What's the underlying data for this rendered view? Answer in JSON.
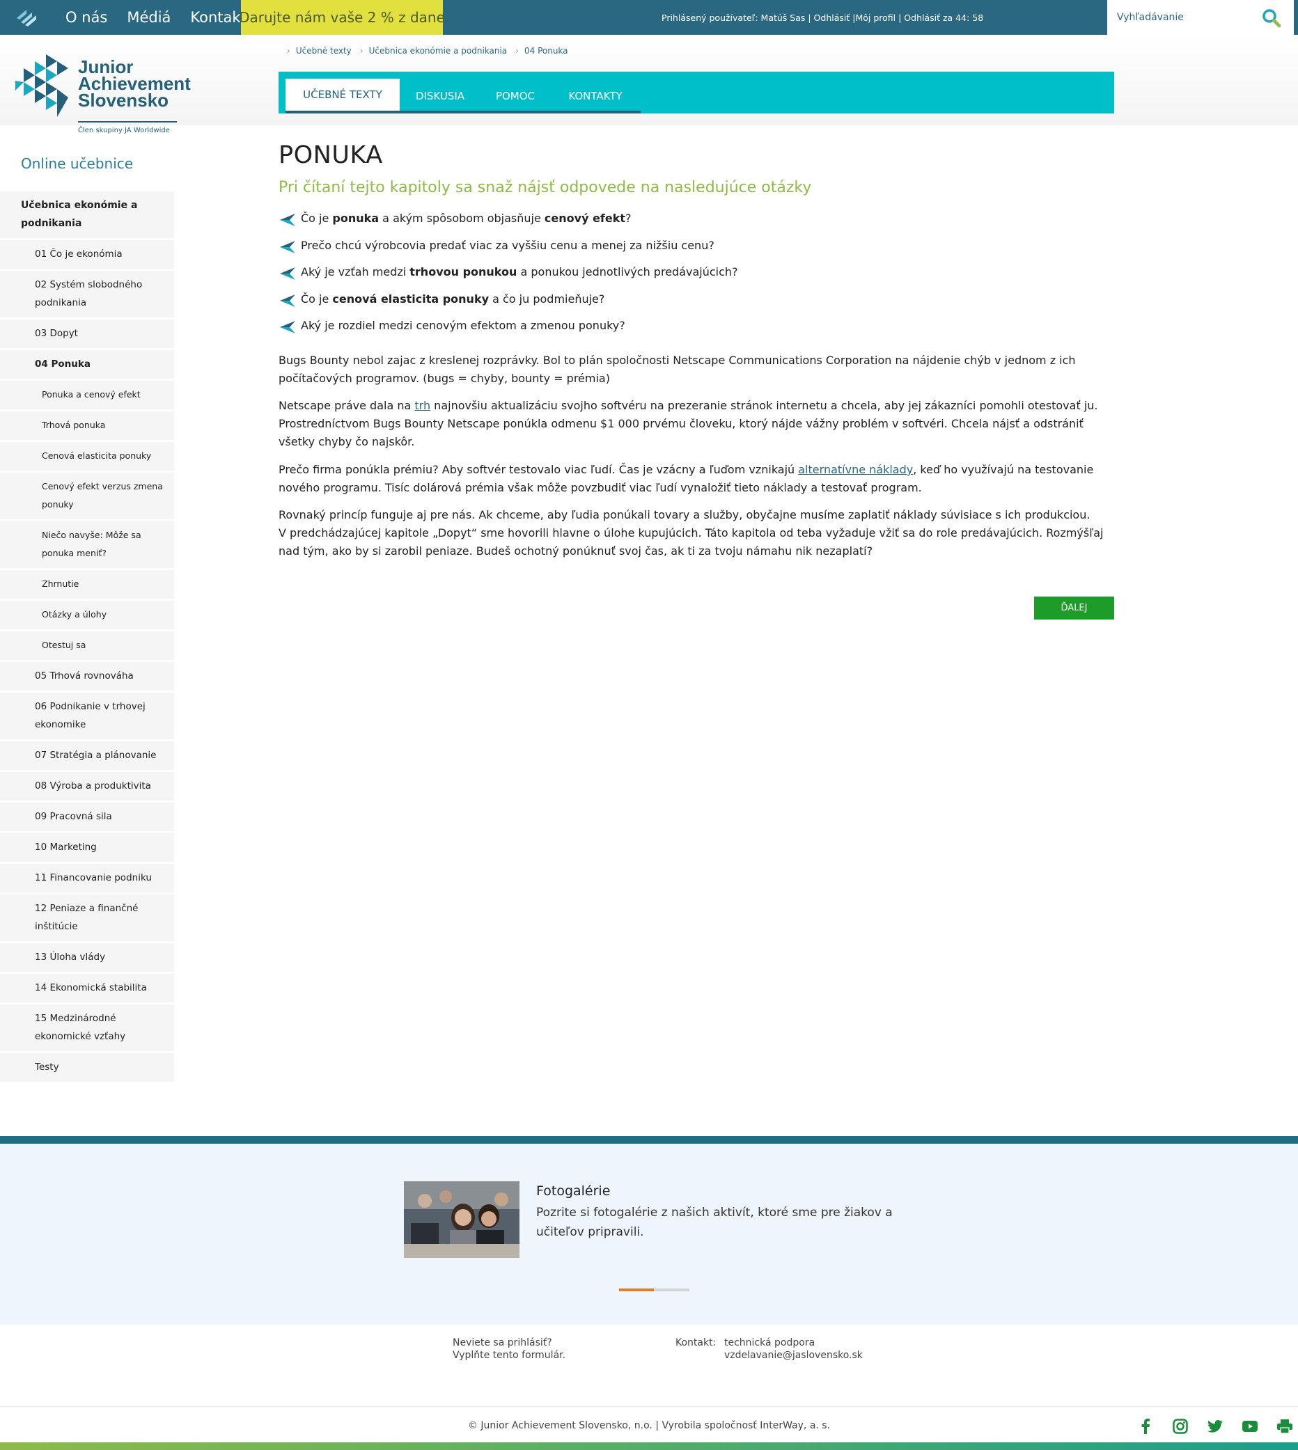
{
  "topbar": {
    "nav": [
      "O nás",
      "Médiá",
      "Kontakt"
    ],
    "donate": "Darujte nám vaše 2 % z dane",
    "user_info": "Prihlásený používateľ: Matúš Sas | Odhlásiť |Môj profil | Odhlásiť za 44: 58",
    "search_placeholder": "Vyhľadávanie"
  },
  "brand": {
    "name_line1": "Junior",
    "name_line2": "Achievement",
    "name_line3": "Slovensko",
    "sub": "Člen skupiny JA Worldwide"
  },
  "sidebar": {
    "title": "Online učebnice",
    "items": [
      {
        "label": "Učebnica ekonómie a podnikania",
        "level": "top"
      },
      {
        "label": "01 Čo je ekonómia",
        "level": "chapter"
      },
      {
        "label": "02 Systém slobodného podnikania",
        "level": "chapter"
      },
      {
        "label": "03 Dopyt",
        "level": "chapter"
      },
      {
        "label": "04 Ponuka",
        "level": "chapter",
        "active": true
      },
      {
        "label": "Ponuka a cenový efekt",
        "level": "sub"
      },
      {
        "label": "Trhová ponuka",
        "level": "sub"
      },
      {
        "label": "Cenová elasticita ponuky",
        "level": "sub"
      },
      {
        "label": "Cenový efekt verzus zmena ponuky",
        "level": "sub"
      },
      {
        "label": "Niečo navyše: Môže sa ponuka meniť?",
        "level": "sub"
      },
      {
        "label": "Zhrnutie",
        "level": "sub"
      },
      {
        "label": "Otázky a úlohy",
        "level": "sub"
      },
      {
        "label": "Otestuj sa",
        "level": "sub"
      },
      {
        "label": "05 Trhová rovnováha",
        "level": "chapter"
      },
      {
        "label": "06 Podnikanie v trhovej ekonomike",
        "level": "chapter"
      },
      {
        "label": "07 Stratégia a plánovanie",
        "level": "chapter"
      },
      {
        "label": "08 Výroba a produktivita",
        "level": "chapter"
      },
      {
        "label": "09 Pracovná sila",
        "level": "chapter"
      },
      {
        "label": "10 Marketing",
        "level": "chapter"
      },
      {
        "label": "11 Financovanie podniku",
        "level": "chapter"
      },
      {
        "label": "12 Peniaze a finančné inštitúcie",
        "level": "chapter"
      },
      {
        "label": "13 Úloha vlády",
        "level": "chapter"
      },
      {
        "label": "14 Ekonomická stabilita",
        "level": "chapter"
      },
      {
        "label": "15 Medzinárodné ekonomické vzťahy",
        "level": "chapter"
      },
      {
        "label": "Testy",
        "level": "chapter"
      }
    ]
  },
  "breadcrumb": [
    "Učebné texty",
    "Učebnica ekonómie a podnikania",
    "04 Ponuka"
  ],
  "tabs": [
    "UČEBNÉ TEXTY",
    "DISKUSIA",
    "POMOC",
    "KONTAKTY"
  ],
  "content": {
    "title": "PONUKA",
    "subtitle": "Pri čítaní tejto kapitoly sa snaž nájsť odpovede na nasledujúce otázky",
    "questions": [
      [
        {
          "t": "Čo je "
        },
        {
          "t": "ponuka",
          "b": true
        },
        {
          "t": " a akým spôsobom objasňuje "
        },
        {
          "t": "cenový efekt",
          "b": true
        },
        {
          "t": "?"
        }
      ],
      [
        {
          "t": "Prečo chcú výrobcovia predať viac za vyššiu cenu a menej za nižšiu cenu?"
        }
      ],
      [
        {
          "t": "Aký je vzťah medzi "
        },
        {
          "t": "trhovou ponukou",
          "b": true
        },
        {
          "t": " a ponukou jednotlivých predávajúcich?"
        }
      ],
      [
        {
          "t": "Čo je "
        },
        {
          "t": "cenová elasticita ponuky",
          "b": true
        },
        {
          "t": " a čo ju podmieňuje?"
        }
      ],
      [
        {
          "t": "Aký je rozdiel medzi cenovým efektom a zmenou ponuky?"
        }
      ]
    ],
    "p1": "Bugs Bounty nebol zajac z kreslenej rozprávky. Bol to plán spoločnosti Netscape Communications Corporation na nájdenie chýb v jednom z ich počítačových programov. (bugs = chyby, bounty = prémia)",
    "p2_before": "Netscape práve dala na ",
    "p2_link": "trh",
    "p2_after": " najnovšiu aktualizáciu svojho softvéru na prezeranie stránok internetu a chcela, aby jej zákazníci pomohli otestovať ju. Prostredníctvom Bugs Bounty Netscape ponúkla odmenu $1 000 prvému človeku, ktorý nájde vážny problém v softvéri. Chcela nájsť a odstrániť všetky chyby čo najskôr.",
    "p3_before": "Prečo firma ponúkla prémiu? Aby softvér testovalo viac ľudí. Čas je vzácny a ľuďom vznikajú ",
    "p3_link": "alternatívne náklady",
    "p3_after": ", keď ho využívajú na testovanie nového programu. Tisíc dolárová prémia však môže povzbudiť viac ľudí vynaložiť tieto náklady a testovať program.",
    "p4_line1": "Rovnaký princíp funguje aj pre nás. Ak chceme, aby ľudia ponúkali tovary a služby, obyčajne musíme zaplatiť náklady súvisiace s ich produkciou.",
    "p4_line2": "V predchádzajúcej kapitole „Dopyt“ sme hovorili hlavne o úlohe kupujúcich. Táto kapitola od teba vyžaduje vžiť sa do role predávajúcich. Rozmýšľaj nad tým, ako by si zarobil peniaze. Budeš ochotný ponúknuť svoj čas, ak ti za tvoju námahu nik nezaplatí?",
    "next_button": "ĎALEJ"
  },
  "promo": {
    "title": "Fotogalérie",
    "text": "Pozrite si fotogalérie z našich aktivít, ktoré sme pre žiakov a učiteľov pripravili."
  },
  "footer": {
    "login_help_line1": "Neviete sa prihlásiť?",
    "login_help_line2": "Vyplňte tento formulár.",
    "contact_label": "Kontakt:",
    "contact_line1": "technická podpora",
    "contact_line2": "vzdelavanie@jaslovensko.sk",
    "copyright": "© Junior Achievement Slovensko, n.o. | Vyrobila spoločnosť InterWay, a. s.",
    "socials": [
      "facebook-icon",
      "instagram-icon",
      "twitter-icon",
      "youtube-icon",
      "print-icon"
    ]
  },
  "colors": {
    "primary": "#2a6882",
    "accent_teal": "#00bfc9",
    "subtitle_green": "#8dbb47",
    "button_green": "#1e9c2a",
    "donate_yellow": "#e1e03f",
    "slider_orange": "#e87d1e"
  }
}
